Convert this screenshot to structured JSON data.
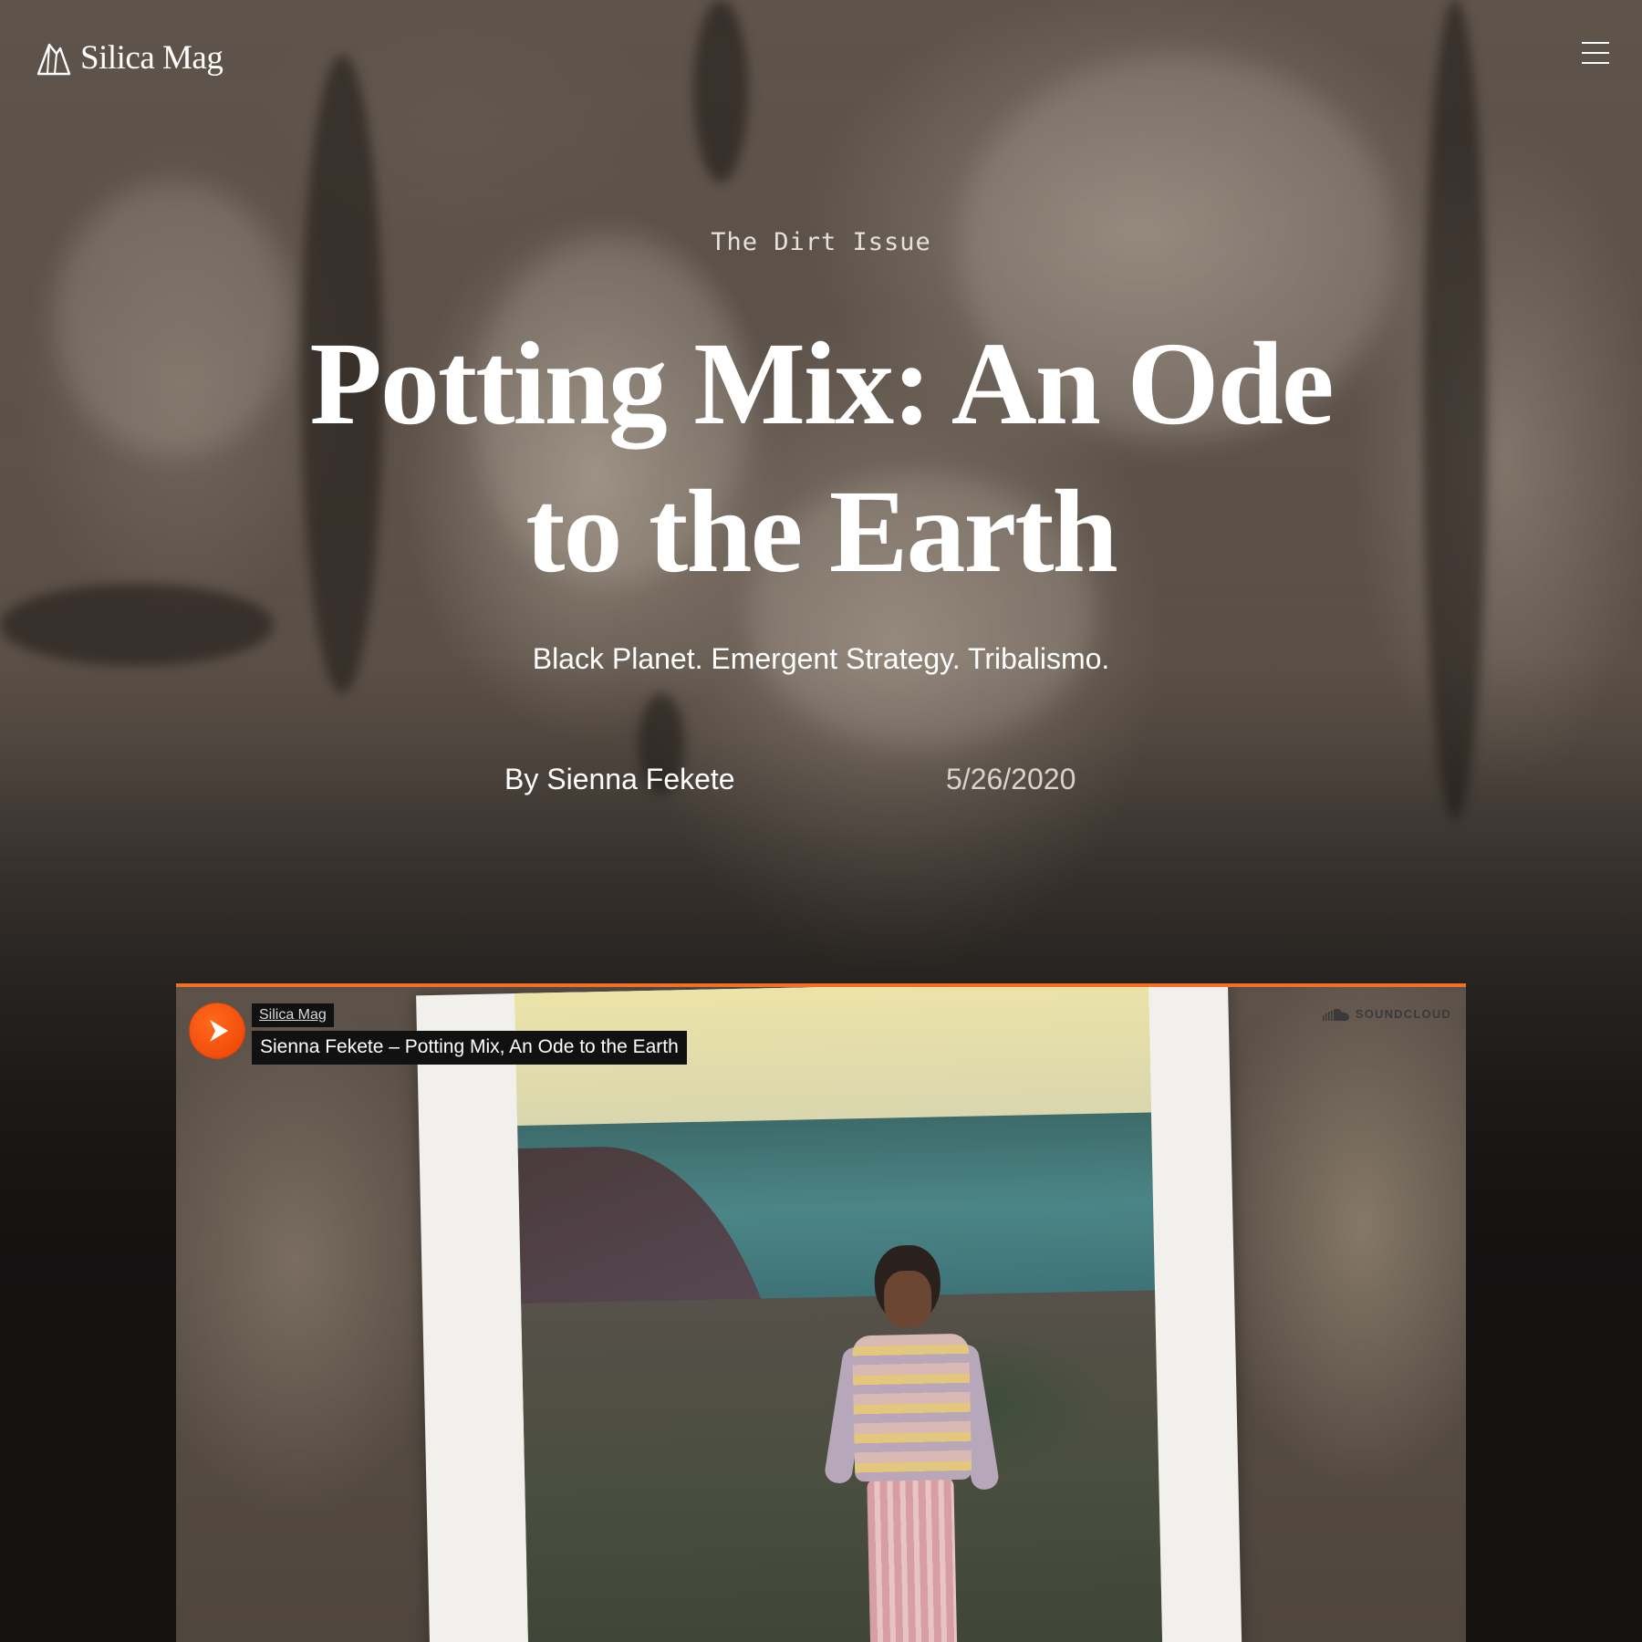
{
  "site": {
    "name": "Silica Mag"
  },
  "article": {
    "issue": "The Dirt Issue",
    "title": "Potting Mix: An Ode to the Earth",
    "subtitle": "Black Planet. Emergent Strategy. Tribalismo.",
    "byline": "By Sienna Fekete",
    "date": "5/26/2020"
  },
  "player": {
    "artist": "Silica Mag",
    "track": "Sienna Fekete – Potting Mix, An Ode to the Earth",
    "brand": "SOUNDCLOUD",
    "accent_color": "#f26f23",
    "play_button_color": "#f24d0c"
  },
  "icons": {
    "logo": "silica-mountain-icon",
    "menu": "hamburger-menu-icon",
    "play": "play-icon",
    "brand": "soundcloud-cloud-icon"
  }
}
